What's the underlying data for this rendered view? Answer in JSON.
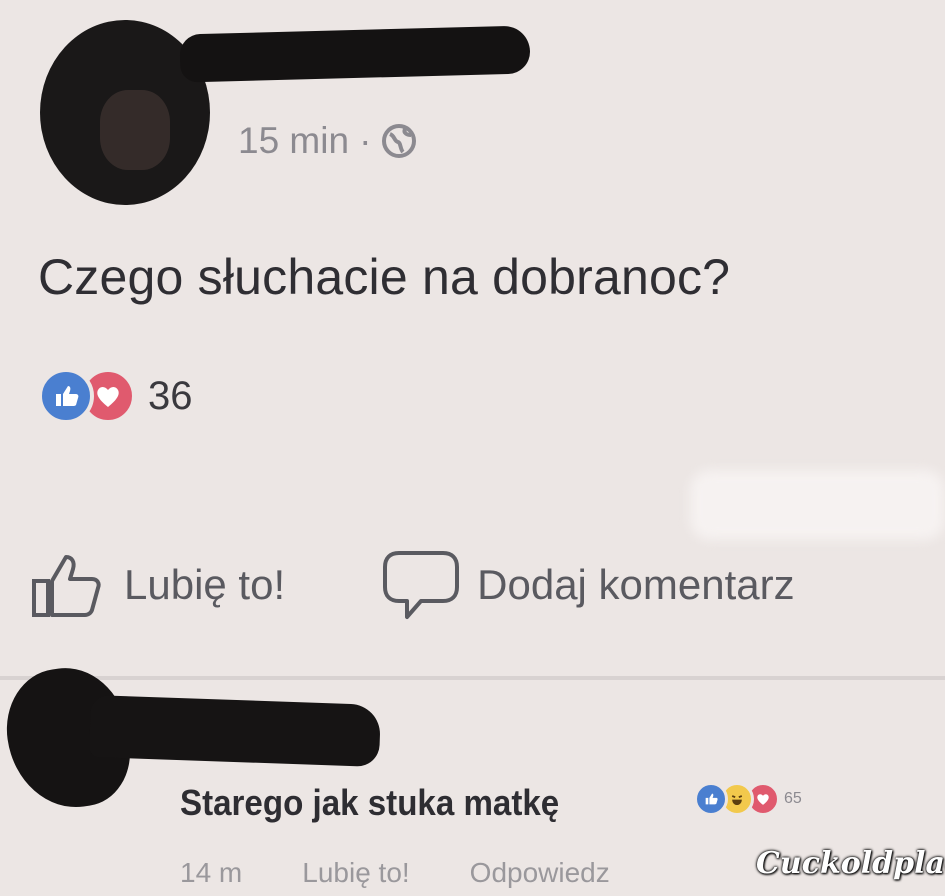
{
  "post": {
    "time": "15 min",
    "separator": "·",
    "privacy_icon": "globe-icon",
    "text": "Czego słuchacie na dobranoc?",
    "reactions": {
      "icons": [
        "like-icon",
        "love-icon"
      ],
      "count": "36"
    },
    "actions": {
      "like_label": "Lubię to!",
      "comment_label": "Dodaj komentarz"
    }
  },
  "comment": {
    "text": "Starego jak stuka matkę",
    "reactions": {
      "icons": [
        "like-icon",
        "haha-icon",
        "love-icon"
      ],
      "count": "65"
    },
    "time": "14 m",
    "like_label": "Lubię to!",
    "reply_label": "Odpowiedz"
  },
  "watermark": "Cuckoldplace",
  "colors": {
    "background": "#ece6e4",
    "like_blue": "#4a7fd0",
    "love_red": "#e05a6e",
    "haha_yellow": "#f2c94c",
    "redaction": "#141212"
  }
}
